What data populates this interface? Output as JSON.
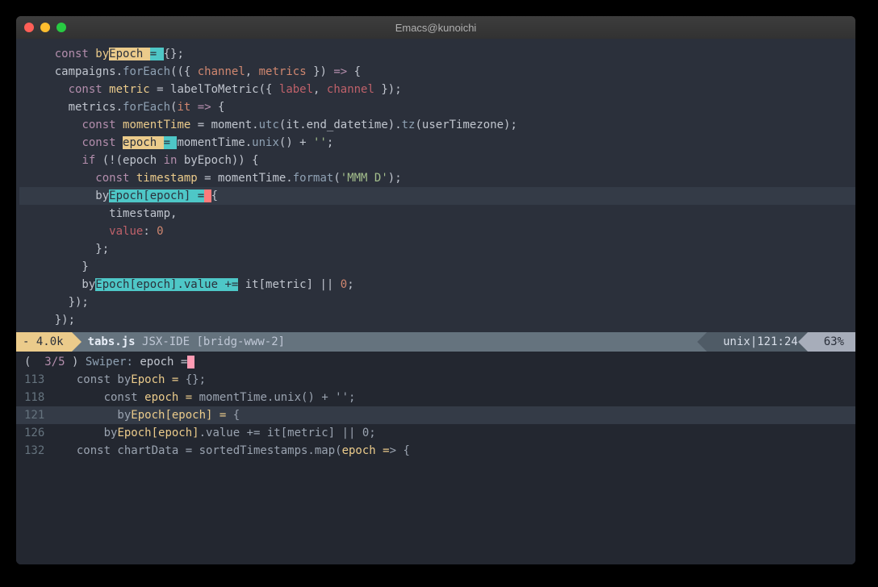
{
  "window": {
    "title": "Emacs@kunoichi"
  },
  "code": {
    "l1": [
      {
        "t": "    ",
        "c": ""
      },
      {
        "t": "const ",
        "c": "kw"
      },
      {
        "t": "by",
        "c": "def"
      },
      {
        "t": "Epoch ",
        "c": "mark-yellow"
      },
      {
        "t": "= ",
        "c": "mark-cyan"
      },
      {
        "t": "{};",
        "c": "pun"
      }
    ],
    "l2": [
      {
        "t": "    campaigns.",
        "c": ""
      },
      {
        "t": "forEach",
        "c": "fn"
      },
      {
        "t": "(({ ",
        "c": "pun"
      },
      {
        "t": "channel",
        "c": "param"
      },
      {
        "t": ", ",
        "c": "pun"
      },
      {
        "t": "metrics",
        "c": "param"
      },
      {
        "t": " }) ",
        "c": "pun"
      },
      {
        "t": "=>",
        "c": "kw"
      },
      {
        "t": " {",
        "c": "pun"
      }
    ],
    "l3": [
      {
        "t": "      ",
        "c": ""
      },
      {
        "t": "const ",
        "c": "kw"
      },
      {
        "t": "metric",
        "c": "def"
      },
      {
        "t": " = labelToMetric({ ",
        "c": ""
      },
      {
        "t": "label",
        "c": "var"
      },
      {
        "t": ", ",
        "c": "pun"
      },
      {
        "t": "channel",
        "c": "var"
      },
      {
        "t": " });",
        "c": "pun"
      }
    ],
    "l4": [
      {
        "t": "      metrics.",
        "c": ""
      },
      {
        "t": "forEach",
        "c": "fn"
      },
      {
        "t": "(",
        "c": "pun"
      },
      {
        "t": "it",
        "c": "param"
      },
      {
        "t": " ",
        "c": ""
      },
      {
        "t": "=>",
        "c": "kw"
      },
      {
        "t": " {",
        "c": "pun"
      }
    ],
    "l5": [
      {
        "t": "        ",
        "c": ""
      },
      {
        "t": "const ",
        "c": "kw"
      },
      {
        "t": "momentTime",
        "c": "def"
      },
      {
        "t": " = moment.",
        "c": ""
      },
      {
        "t": "utc",
        "c": "fn"
      },
      {
        "t": "(it.end_datetime).",
        "c": ""
      },
      {
        "t": "tz",
        "c": "fn"
      },
      {
        "t": "(userTimezone);",
        "c": ""
      }
    ],
    "l6": [
      {
        "t": "        ",
        "c": ""
      },
      {
        "t": "const ",
        "c": "kw"
      },
      {
        "t": "epoch ",
        "c": "mark-yellow"
      },
      {
        "t": "= ",
        "c": "mark-cyan"
      },
      {
        "t": "momentTime.",
        "c": ""
      },
      {
        "t": "unix",
        "c": "fn"
      },
      {
        "t": "() + ",
        "c": ""
      },
      {
        "t": "''",
        "c": "str"
      },
      {
        "t": ";",
        "c": "pun"
      }
    ],
    "l7": [
      {
        "t": "        ",
        "c": ""
      },
      {
        "t": "if",
        "c": "kw"
      },
      {
        "t": " (!(epoch ",
        "c": ""
      },
      {
        "t": "in",
        "c": "kw"
      },
      {
        "t": " byEpoch)) {",
        "c": ""
      }
    ],
    "l8": [
      {
        "t": "          ",
        "c": ""
      },
      {
        "t": "const ",
        "c": "kw"
      },
      {
        "t": "timestamp",
        "c": "def"
      },
      {
        "t": " = momentTime.",
        "c": ""
      },
      {
        "t": "format",
        "c": "fn"
      },
      {
        "t": "(",
        "c": "pun"
      },
      {
        "t": "'MMM D'",
        "c": "str"
      },
      {
        "t": ");",
        "c": "pun"
      }
    ],
    "l9": [
      {
        "t": "          by",
        "c": ""
      },
      {
        "t": "Epoch[epoch] =",
        "c": "mark-cyan"
      },
      {
        "t": " ",
        "c": "cursor"
      },
      {
        "t": "{",
        "c": "pun"
      }
    ],
    "l10": [
      {
        "t": "            timestamp,",
        "c": ""
      }
    ],
    "l11": [
      {
        "t": "            ",
        "c": ""
      },
      {
        "t": "value",
        "c": "var"
      },
      {
        "t": ": ",
        "c": ""
      },
      {
        "t": "0",
        "c": "num"
      }
    ],
    "l12": [
      {
        "t": "          };",
        "c": ""
      }
    ],
    "l13": [
      {
        "t": "        }",
        "c": ""
      }
    ],
    "l14": [
      {
        "t": "        by",
        "c": ""
      },
      {
        "t": "Epoch[epoch].value +=",
        "c": "mark-cyan"
      },
      {
        "t": " it[metric] || ",
        "c": ""
      },
      {
        "t": "0",
        "c": "num"
      },
      {
        "t": ";",
        "c": "pun"
      }
    ],
    "l15": [
      {
        "t": "      });",
        "c": ""
      }
    ],
    "l16": [
      {
        "t": "    });",
        "c": ""
      }
    ]
  },
  "modeline": {
    "left": "- 4.0k",
    "filename": "tabs.js",
    "mode": "JSX-IDE",
    "branch": "[bridg-www-2]",
    "encoding": "unix",
    "position": "121:24",
    "percent": "63%"
  },
  "swiper": {
    "count": "3/5",
    "label": "Swiper:",
    "query": "epoch =",
    "results": [
      {
        "num": "113",
        "pre": "  const by",
        "match": "Epoch =",
        "post": " {};"
      },
      {
        "num": "118",
        "pre": "      const ",
        "match": "epoch =",
        "post": " momentTime.unix() + '';"
      },
      {
        "num": "121",
        "pre": "        by",
        "match": "Epoch[epoch] =",
        "post": " {",
        "sel": true
      },
      {
        "num": "126",
        "pre": "      by",
        "match": "Epoch[epoch]",
        "post": ".value += it[metric] || 0;"
      },
      {
        "num": "132",
        "pre": "  const chartData = sortedTimestamps.map(",
        "match": "epoch =",
        "post": "> {"
      }
    ]
  }
}
